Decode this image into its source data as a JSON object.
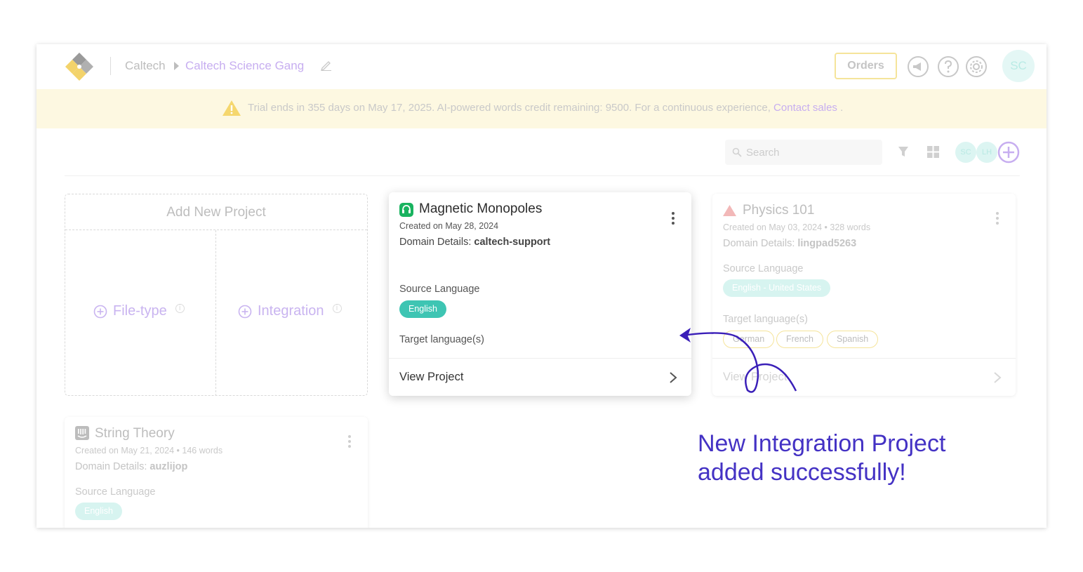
{
  "header": {
    "org": "Caltech",
    "team": "Caltech Science Gang",
    "orders_label": "Orders",
    "avatar_initials": "SC",
    "icons": [
      "announcement-icon",
      "help-icon",
      "settings-icon"
    ]
  },
  "banner": {
    "text": "Trial ends in 355 days on May 17, 2025. AI-powered words credit remaining: 9500. For a continuous experience,",
    "link": "Contact sales",
    "suffix": "."
  },
  "toolbar": {
    "search_placeholder": "Search",
    "members": [
      "SC",
      "LH"
    ]
  },
  "add_project": {
    "title": "Add New Project",
    "options": [
      "File-type",
      "Integration"
    ],
    "info_glyph": "i"
  },
  "cards": {
    "main": {
      "title": "Magnetic Monopoles",
      "created": "Created on May 28, 2024",
      "domain_label": "Domain Details:",
      "domain_value": "caltech-support",
      "source_label": "Source Language",
      "source_lang": "English",
      "target_label": "Target language(s)",
      "footer": "View Project"
    },
    "physics": {
      "title": "Physics 101",
      "created": "Created on May 03, 2024",
      "words": "328 words",
      "domain_label": "Domain Details:",
      "domain_value": "lingpad5263",
      "source_label": "Source Language",
      "source_lang": "English - United States",
      "target_label": "Target language(s)",
      "targets": [
        "German",
        "French",
        "Spanish"
      ],
      "footer": "View Project"
    },
    "string": {
      "title": "String Theory",
      "created": "Created on May 21, 2024",
      "words": "146 words",
      "domain_label": "Domain Details:",
      "domain_value": "auzlijop",
      "source_label": "Source Language",
      "source_lang": "English"
    }
  },
  "callout": {
    "line1": "New Integration Project",
    "line2": "added successfully!"
  },
  "colors": {
    "accent_purple": "#4432c4",
    "teal": "#3ec5b3",
    "banner_bg": "#fdf8e1"
  }
}
